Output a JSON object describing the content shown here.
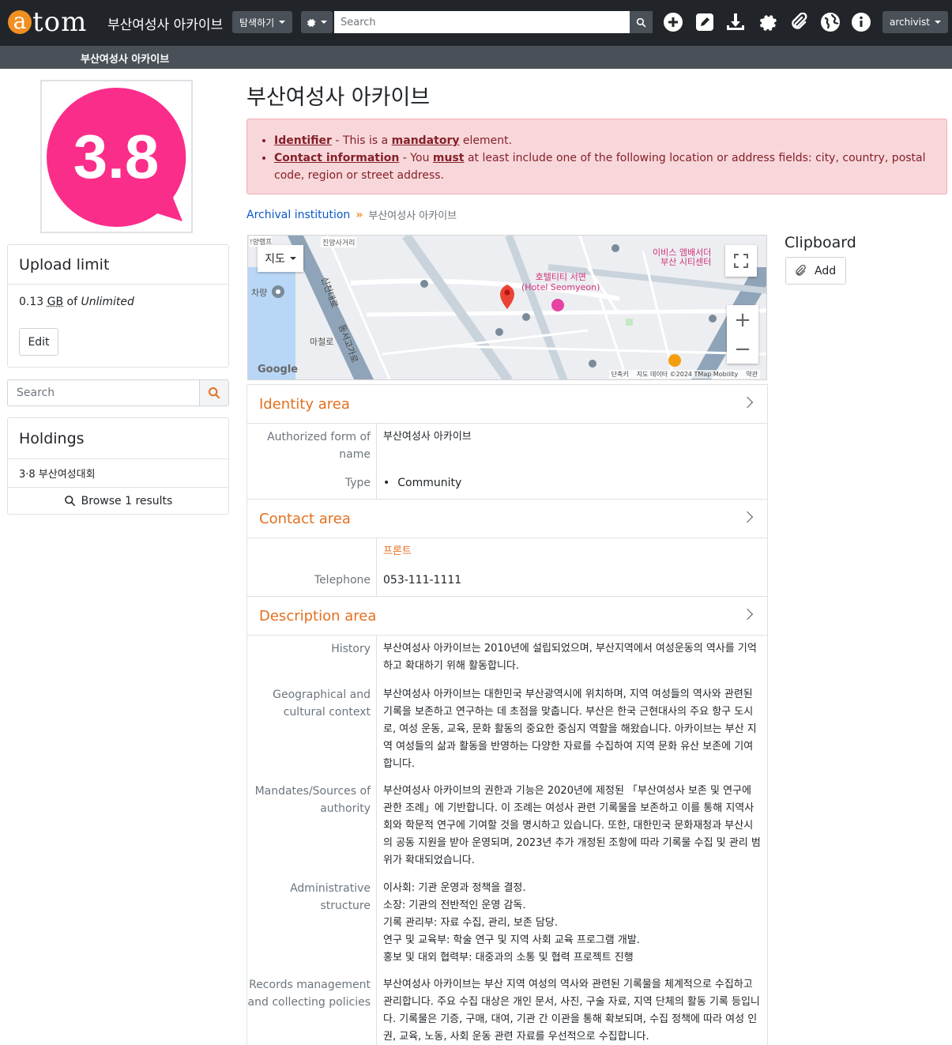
{
  "app": {
    "logo_letter": "a",
    "logo_rest": "tom",
    "site_name": "부산여성사 아카이브",
    "nav_browse": "탐색하기",
    "search_placeholder": "Search",
    "user_menu": "archivist",
    "subbar_title": "부산여성사 아카이브"
  },
  "sidebar": {
    "logo_text": "3.8",
    "upload": {
      "title": "Upload limit",
      "used": "0.13",
      "unit": "GB",
      "of": "of",
      "limit": "Unlimited",
      "edit_label": "Edit"
    },
    "search_placeholder": "Search",
    "holdings": {
      "title": "Holdings",
      "item": "3·8 부산여성대회",
      "browse_label": "Browse 1 results"
    }
  },
  "main": {
    "title": "부산여성사 아카이브",
    "alerts": [
      {
        "field": "Identifier",
        "pre": " - This is a ",
        "strong": "mandatory",
        "post": " element."
      },
      {
        "field": "Contact information",
        "pre": " - You ",
        "strong": "must",
        "post": " at least include one of the following location or address fields: city, country, postal code, region or street address."
      }
    ],
    "breadcrumb": {
      "parent": "Archival institution",
      "sep": "»",
      "current": "부산여성사 아카이브"
    },
    "map": {
      "map_type": "지도",
      "poi_hotel": "호텔티티 서면",
      "poi_hotel_en": "(Hotel Seomyeon)",
      "poi_top": "이비스 앰배서더",
      "poi_top2": "부산 시티센터",
      "road1": "신천대로",
      "road2": "동서고가로",
      "place1": "차량",
      "place2": "마철로",
      "place3": "진양사거리",
      "place4": "!양램프",
      "google": "Google",
      "footer1": "단축키",
      "footer2": "지도 데이터 ©2024 TMap Mobility",
      "footer3": "약관"
    },
    "identity": {
      "title": "Identity area",
      "auth_label": "Authorized form of name",
      "auth_value": "부산여성사 아카이브",
      "type_label": "Type",
      "type_value": "Community"
    },
    "contact": {
      "title": "Contact area",
      "contact_name": "프론트",
      "tel_label": "Telephone",
      "tel_value": "053-111-1111"
    },
    "description": {
      "title": "Description area",
      "history_label": "History",
      "history": "부산여성사 아카이브는 2010년에 설립되었으며, 부산지역에서 여성운동의 역사를 기억하고 확대하기 위해 활동합니다.",
      "geo_label": "Geographical and cultural context",
      "geo": "부산여성사 아카이브는 대한민국 부산광역시에 위치하며, 지역 여성들의 역사와 관련된 기록을 보존하고 연구하는 데 초점을 맞춥니다. 부산은 한국 근현대사의 주요 항구 도시로, 여성 운동, 교육, 문화 활동의 중요한 중심지 역할을 해왔습니다. 아카이브는 부산 지역 여성들의 삶과 활동을 반영하는 다양한 자료를 수집하여 지역 문화 유산 보존에 기여합니다.",
      "mandates_label": "Mandates/Sources of authority",
      "mandates": "부산여성사 아카이브의 권한과 기능은 2020년에 제정된 「부산여성사 보존 및 연구에 관한 조례」에 기반합니다. 이 조례는 여성사 관련 기록물을 보존하고 이를 통해 지역사회와 학문적 연구에 기여할 것을 명시하고 있습니다. 또한, 대한민국 문화재청과 부산시의 공동 지원을 받아 운영되며, 2023년 추가 개정된 조항에 따라 기록물 수집 및 관리 범위가 확대되었습니다.",
      "admin_label": "Administrative structure",
      "admin": [
        "이사회: 기관 운영과 정책을 결정.",
        "소장: 기관의 전반적인 운영 감독.",
        "기록 관리부: 자료 수집, 관리, 보존 담당.",
        "연구 및 교육부: 학술 연구 및 지역 사회 교육 프로그램 개발.",
        "홍보 및 대외 협력부: 대중과의 소통 및 협력 프로젝트 진행"
      ],
      "records_label": "Records management and collecting policies",
      "records": "부산여성사 아카이브는 부산 지역 여성의 역사와 관련된 기록물을 체계적으로 수집하고 관리합니다. 주요 수집 대상은 개인 문서, 사진, 구술 자료, 지역 단체의 활동 기록 등입니다. 기록물은 기증, 구매, 대여, 기관 간 이관을 통해 확보되며, 수집 정책에 따라 여성 인권, 교육, 노동, 사회 운동 관련 자료를 우선적으로 수집합니다."
    }
  },
  "clipboard": {
    "title": "Clipboard",
    "add_label": "Add"
  },
  "colors": {
    "accent": "#e36f1e",
    "navbar": "#212529",
    "subbar": "#495057",
    "logo_pink": "#fb2d8a",
    "alert_bg": "#f8d7da"
  }
}
